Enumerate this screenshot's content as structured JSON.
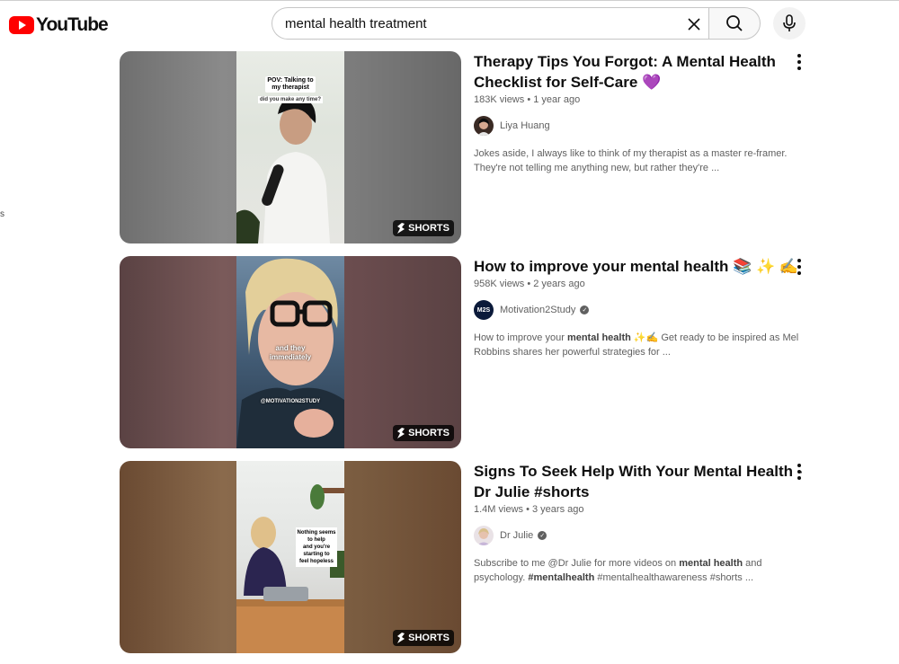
{
  "header": {
    "logo_text": "YouTube",
    "search_value": "mental health treatment"
  },
  "stray_text": "s",
  "results": [
    {
      "title": "Therapy Tips You Forgot: A Mental Health Checklist for Self-Care 💜",
      "views": "183K views",
      "age": "1 year ago",
      "channel": "Liya Huang",
      "verified": false,
      "desc_parts": [
        "Jokes aside, I always like to think of my therapist as a master re-framer. They're not telling me anything new, but rather they're ..."
      ],
      "badge": "SHORTS",
      "caption": [
        "POV: Talking to",
        "my therapist",
        "did you make any time?"
      ]
    },
    {
      "title": "How to improve your mental health 📚 ✨ ✍️",
      "views": "958K views",
      "age": "2 years ago",
      "channel": "Motivation2Study",
      "verified": true,
      "desc_parts": [
        "How to improve your ",
        "mental health",
        " ✨✍️ Get ready to be inspired as Mel Robbins shares her powerful strategies for ..."
      ],
      "badge": "SHORTS",
      "caption": [
        "and they",
        "immediately",
        "@MOTIVATION2STUDY"
      ]
    },
    {
      "title": "Signs To Seek Help With Your Mental Health - Dr Julie #shorts",
      "views": "1.4M views",
      "age": "3 years ago",
      "channel": "Dr Julie",
      "verified": true,
      "desc_parts": [
        "Subscribe to me @Dr Julie for more videos on ",
        "mental health",
        " and psychology. ",
        "#mentalhealth",
        " #mentalhealthawareness #shorts ..."
      ],
      "badge": "SHORTS",
      "caption": [
        "Nothing seems",
        "to help",
        "and you're",
        "starting to",
        "feel hopeless"
      ]
    }
  ],
  "colors": {
    "brand_red": "#ff0000",
    "text_primary": "#0f0f0f",
    "text_secondary": "#606060"
  },
  "icons": [
    "youtube-logo-icon",
    "clear-icon",
    "search-icon",
    "mic-icon",
    "shorts-icon",
    "verified-icon",
    "more-vert-icon"
  ]
}
